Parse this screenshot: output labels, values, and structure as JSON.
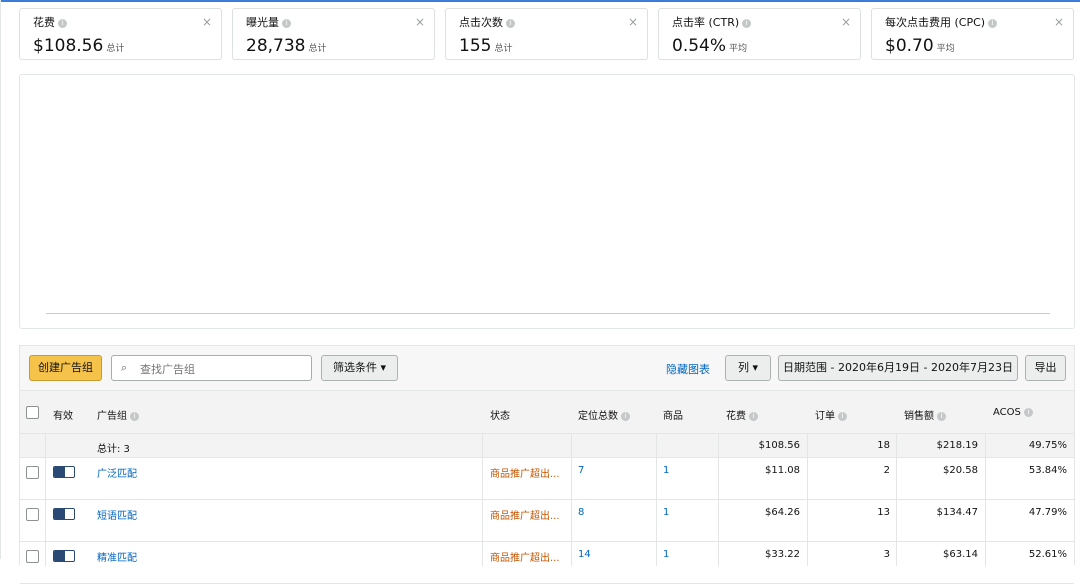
{
  "metrics": [
    {
      "label": "花费",
      "value": "$108.56",
      "sub": "总计"
    },
    {
      "label": "曝光量",
      "value": "28,738",
      "sub": "总计"
    },
    {
      "label": "点击次数",
      "value": "155",
      "sub": "总计"
    },
    {
      "label": "点击率 (CTR)",
      "value": "0.54%",
      "sub": "平均"
    },
    {
      "label": "每次点击费用 (CPC)",
      "value": "$0.70",
      "sub": "平均"
    }
  ],
  "icons": {
    "info": "i",
    "close": "×",
    "search": "⌕",
    "chevron": "▾"
  },
  "toolbar": {
    "create_label": "创建广告组",
    "search_placeholder": "查找广告组",
    "filter_label": "筛选条件",
    "hide_chart_label": "隐藏图表",
    "columns_label": "列",
    "date_range_label": "日期范围 - 2020年6月19日 - 2020年7月23日",
    "export_label": "导出"
  },
  "table": {
    "headers": {
      "active": "有效",
      "ad_group": "广告组",
      "status": "状态",
      "targets": "定位总数",
      "products": "商品",
      "spend": "花费",
      "orders": "订单",
      "sales": "销售额",
      "acos": "ACOS"
    },
    "totals": {
      "label": "总计: 3",
      "spend": "$108.56",
      "orders": "18",
      "sales": "$218.19",
      "acos": "49.75%"
    },
    "rows": [
      {
        "name": "广泛匹配",
        "status": "商品推广超出...",
        "targets": "7",
        "products": "1",
        "spend": "$11.08",
        "orders": "2",
        "sales": "$20.58",
        "acos": "53.84%"
      },
      {
        "name": "短语匹配",
        "status": "商品推广超出...",
        "targets": "8",
        "products": "1",
        "spend": "$64.26",
        "orders": "13",
        "sales": "$134.47",
        "acos": "47.79%"
      },
      {
        "name": "精准匹配",
        "status": "商品推广超出...",
        "targets": "14",
        "products": "1",
        "spend": "$33.22",
        "orders": "3",
        "sales": "$63.14",
        "acos": "52.61%"
      }
    ]
  }
}
